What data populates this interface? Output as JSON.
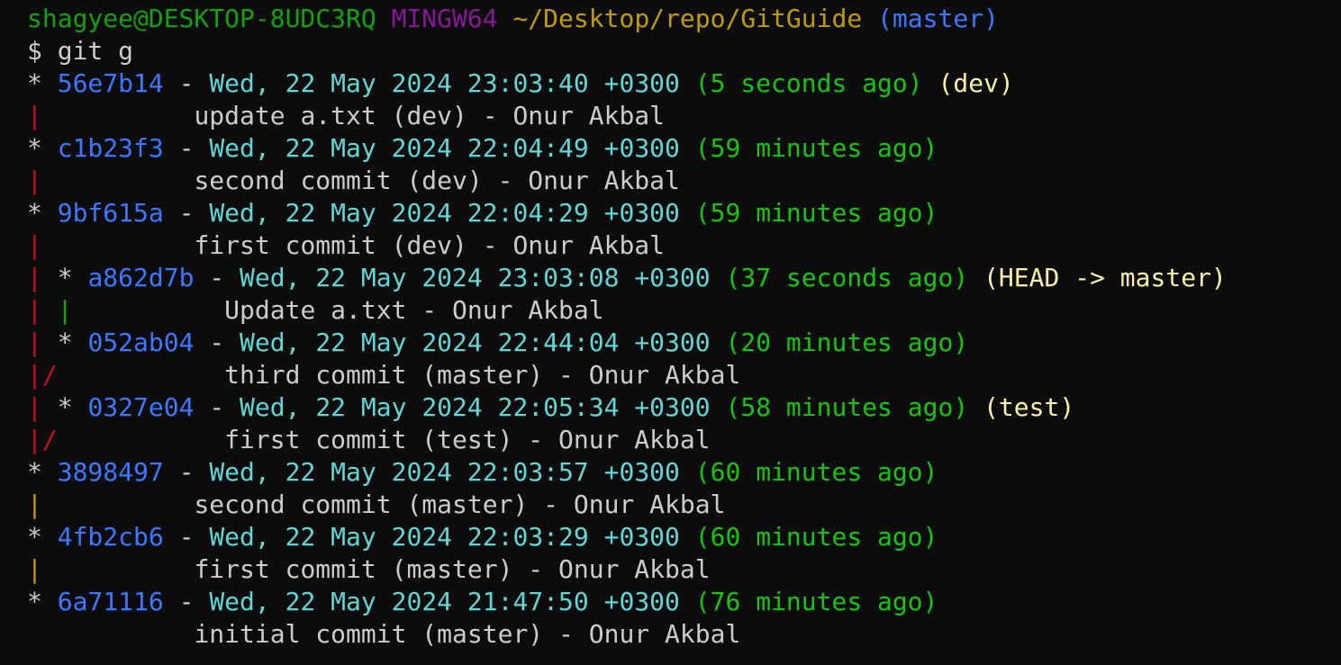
{
  "prompt": {
    "user_host": "shagyee@DESKTOP-8UDC3RQ",
    "shell": "MINGW64",
    "path": "~/Desktop/repo/GitGuide",
    "branch": "(master)",
    "symbol": "$",
    "command": "git g"
  },
  "colors": {
    "background": "#0c0c0c",
    "text": "#cccccc",
    "prompt_user": "#13a10e",
    "prompt_shell": "#881798",
    "prompt_path": "#c19c00",
    "prompt_branch": "#3b78ff",
    "hash": "#3b78ff",
    "date": "#61d6d6",
    "relative": "#16c60c",
    "refs": "#f9f1a5",
    "graph_red": "#c50f1f",
    "graph_green": "#13a10e",
    "graph_gold": "#c19c00"
  },
  "log": [
    {
      "hash": "56e7b14",
      "date": "Wed, 22 May 2024 23:03:40 +0300",
      "rel": "(5 seconds ago)",
      "refs": "(dev)",
      "message": "update a.txt (dev) - Onur Akbal"
    },
    {
      "hash": "c1b23f3",
      "date": "Wed, 22 May 2024 22:04:49 +0300",
      "rel": "(59 minutes ago)",
      "refs": "",
      "message": "second commit (dev) - Onur Akbal"
    },
    {
      "hash": "9bf615a",
      "date": "Wed, 22 May 2024 22:04:29 +0300",
      "rel": "(59 minutes ago)",
      "refs": "",
      "message": "first commit (dev) - Onur Akbal"
    },
    {
      "hash": "a862d7b",
      "date": "Wed, 22 May 2024 23:03:08 +0300",
      "rel": "(37 seconds ago)",
      "refs": "(HEAD -> master)",
      "message": "Update a.txt - Onur Akbal"
    },
    {
      "hash": "052ab04",
      "date": "Wed, 22 May 2024 22:44:04 +0300",
      "rel": "(20 minutes ago)",
      "refs": "",
      "message": "third commit (master) - Onur Akbal"
    },
    {
      "hash": "0327e04",
      "date": "Wed, 22 May 2024 22:05:34 +0300",
      "rel": "(58 minutes ago)",
      "refs": "(test)",
      "message": "first commit (test) - Onur Akbal"
    },
    {
      "hash": "3898497",
      "date": "Wed, 22 May 2024 22:03:57 +0300",
      "rel": "(60 minutes ago)",
      "refs": "",
      "message": "second commit (master) - Onur Akbal"
    },
    {
      "hash": "4fb2cb6",
      "date": "Wed, 22 May 2024 22:03:29 +0300",
      "rel": "(60 minutes ago)",
      "refs": "",
      "message": "first commit (master) - Onur Akbal"
    },
    {
      "hash": "6a71116",
      "date": "Wed, 22 May 2024 21:47:50 +0300",
      "rel": "(76 minutes ago)",
      "refs": "",
      "message": "initial commit (master) - Onur Akbal"
    }
  ],
  "graph": {
    "star": "*",
    "pipe": "|",
    "slash": "/",
    "dash": "-"
  }
}
